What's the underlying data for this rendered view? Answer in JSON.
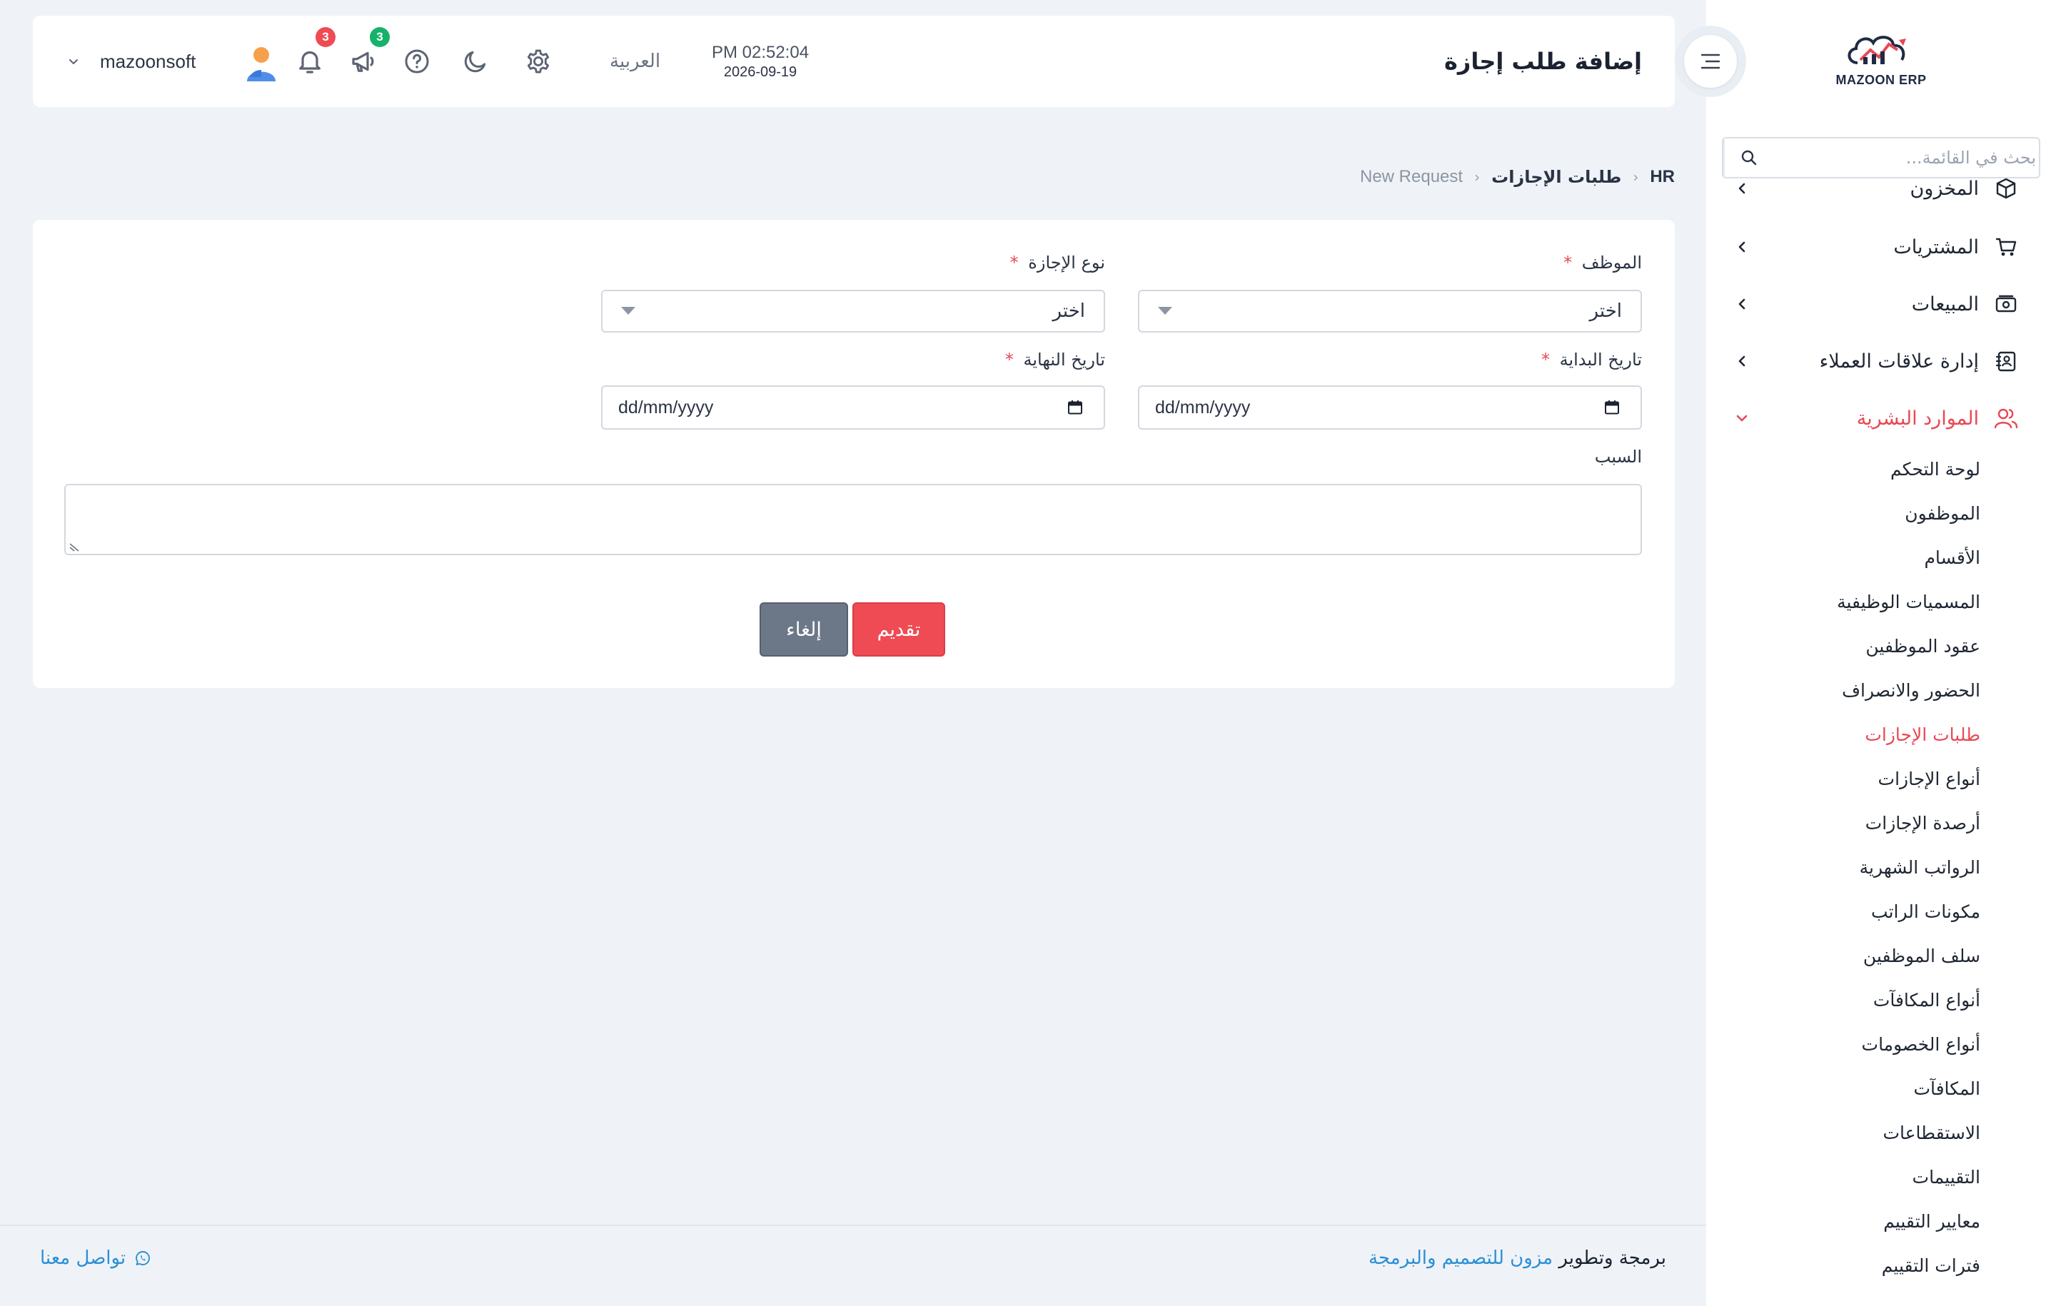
{
  "header": {
    "title": "إضافة طلب إجازة",
    "clock_time": "PM 02:52:04",
    "clock_date": "2026-09-19",
    "language": "العربية",
    "notifications_count": "3",
    "announcements_count": "3",
    "username": "mazoonsoft"
  },
  "sidebar": {
    "logo_text": "MAZOON ERP",
    "search_placeholder": "بحث في القائمة...",
    "menu": [
      {
        "label": "المخزون",
        "icon": "box-icon"
      },
      {
        "label": "المشتريات",
        "icon": "cart-icon"
      },
      {
        "label": "المبيعات",
        "icon": "cash-icon"
      },
      {
        "label": "إدارة علاقات العملاء",
        "icon": "contacts-icon"
      },
      {
        "label": "الموارد البشرية",
        "icon": "users-icon"
      }
    ],
    "hr_submenu": [
      "لوحة التحكم",
      "الموظفون",
      "الأقسام",
      "المسميات الوظيفية",
      "عقود الموظفين",
      "الحضور والانصراف",
      "طلبات الإجازات",
      "أنواع الإجازات",
      "أرصدة الإجازات",
      "الرواتب الشهرية",
      "مكونات الراتب",
      "سلف الموظفين",
      "أنواع المكافآت",
      "أنواع الخصومات",
      "المكافآت",
      "الاستقطاعات",
      "التقييمات",
      "معايير التقييم",
      "فترات التقييم"
    ],
    "active_submenu": "طلبات الإجازات",
    "accent_color": "#e84855"
  },
  "breadcrumb": {
    "root": "HR",
    "section": "طلبات الإجازات",
    "current": "New Request"
  },
  "form": {
    "employee_label": "الموظف",
    "employee_value": "اختر",
    "leave_type_label": "نوع الإجازة",
    "leave_type_value": "اختر",
    "start_date_label": "تاريخ البداية",
    "start_date_value": "dd/mm/yyyy",
    "end_date_label": "تاريخ النهاية",
    "end_date_value": "dd/mm/yyyy",
    "reason_label": "السبب",
    "reason_value": "",
    "required_mark": "*",
    "submit_label": "تقديم",
    "cancel_label": "إلغاء"
  },
  "footer": {
    "credit_prefix": "برمجة وتطوير",
    "credit_link": "مزون للتصميم والبرمجة",
    "contact": "تواصل معنا"
  }
}
